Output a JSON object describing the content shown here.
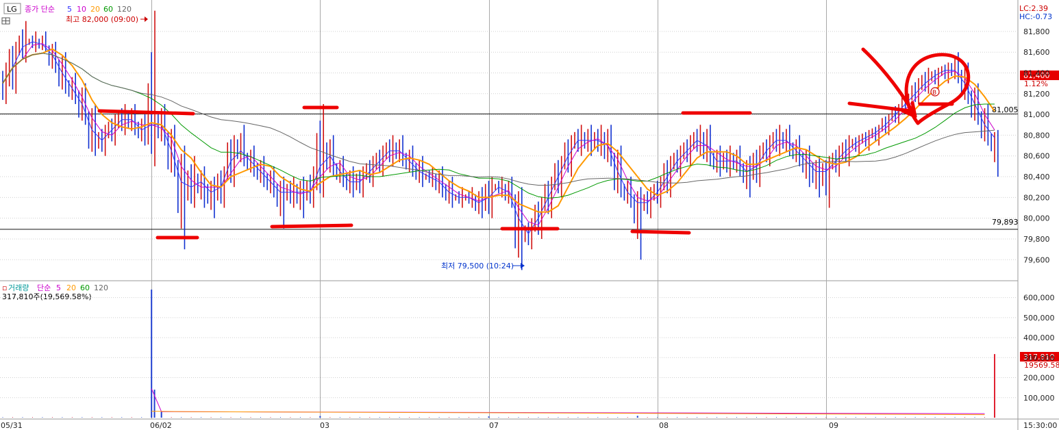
{
  "price_panel": {
    "ticker": "LG",
    "legend": {
      "title": "종가 단순",
      "periods": [
        "5",
        "10",
        "20",
        "60",
        "120"
      ],
      "colors": [
        "#3333ff",
        "#cc00cc",
        "#ff9900",
        "#009900",
        "#666666"
      ]
    },
    "high_marker": "최고 82,000 (09:00)",
    "low_marker": "최저 79,500 (10:24)",
    "top_right": {
      "lc": "LC:2.39",
      "hc": "HC:-0.73"
    },
    "current_price": "81,400",
    "current_change": "1.12%",
    "support_label": "79,893",
    "resistance_label": "81,005"
  },
  "volume_panel": {
    "title": "거래량",
    "legend": {
      "title": "단순",
      "periods": [
        "5",
        "20",
        "60",
        "120"
      ]
    },
    "current_line": "317,810주(19,569.58%)",
    "current_volume": "317,810",
    "current_pct": "19569.58%"
  },
  "x_axis": {
    "dates": [
      "05/31",
      "06/02",
      "03",
      "07",
      "08",
      "09"
    ],
    "time_label": "15:30:00"
  },
  "chart_data": [
    {
      "type": "bar",
      "title": "LG",
      "y_ticks": [
        "81,800",
        "81,600",
        "81,400",
        "81,200",
        "81,000",
        "80,800",
        "80,600",
        "80,400",
        "80,200",
        "80,000",
        "79,800",
        "79,600"
      ],
      "ylim": [
        79450,
        82050
      ],
      "high": 82000,
      "low": 79500,
      "horizontal_lines": [
        81005,
        79893
      ],
      "bars": [
        {
          "x": 0,
          "o": 81200,
          "h": 81500,
          "l": 81100,
          "c": 81300
        },
        {
          "x": 1,
          "o": 81300,
          "h": 81700,
          "l": 81200,
          "c": 81600
        },
        {
          "x": 2,
          "o": 81600,
          "h": 81900,
          "l": 81500,
          "c": 81700
        },
        {
          "x": 3,
          "o": 81700,
          "h": 81800,
          "l": 81600,
          "c": 81700
        },
        {
          "x": 4,
          "o": 81700,
          "h": 81800,
          "l": 81600,
          "c": 81650
        },
        {
          "x": 5,
          "o": 81650,
          "h": 81700,
          "l": 81400,
          "c": 81500
        },
        {
          "x": 6,
          "o": 81500,
          "h": 81600,
          "l": 81200,
          "c": 81300
        },
        {
          "x": 7,
          "o": 81300,
          "h": 81400,
          "l": 81100,
          "c": 81200
        },
        {
          "x": 8,
          "o": 81200,
          "h": 81300,
          "l": 80900,
          "c": 81000
        },
        {
          "x": 9,
          "o": 81000,
          "h": 81100,
          "l": 80600,
          "c": 80700
        },
        {
          "x": 10,
          "o": 80700,
          "h": 80900,
          "l": 80600,
          "c": 80800
        },
        {
          "x": 11,
          "o": 80800,
          "h": 81000,
          "l": 80700,
          "c": 80900
        },
        {
          "x": 12,
          "o": 80900,
          "h": 81100,
          "l": 80800,
          "c": 81000
        },
        {
          "x": 13,
          "o": 81000,
          "h": 81100,
          "l": 80800,
          "c": 80900
        },
        {
          "x": 14,
          "o": 80900,
          "h": 81000,
          "l": 80700,
          "c": 80800
        },
        {
          "x": 15,
          "o": 80800,
          "h": 82000,
          "l": 80500,
          "c": 81000
        },
        {
          "x": 16,
          "o": 81000,
          "h": 81100,
          "l": 80700,
          "c": 80800
        },
        {
          "x": 17,
          "o": 80800,
          "h": 80900,
          "l": 80400,
          "c": 80500
        },
        {
          "x": 18,
          "o": 80500,
          "h": 80700,
          "l": 79700,
          "c": 80200
        },
        {
          "x": 19,
          "o": 80200,
          "h": 80600,
          "l": 80100,
          "c": 80400
        },
        {
          "x": 20,
          "o": 80400,
          "h": 80500,
          "l": 80100,
          "c": 80300
        },
        {
          "x": 21,
          "o": 80300,
          "h": 80400,
          "l": 80000,
          "c": 80200
        },
        {
          "x": 22,
          "o": 80200,
          "h": 80500,
          "l": 80100,
          "c": 80400
        },
        {
          "x": 23,
          "o": 80400,
          "h": 80800,
          "l": 80300,
          "c": 80700
        },
        {
          "x": 24,
          "o": 80700,
          "h": 80900,
          "l": 80500,
          "c": 80600
        },
        {
          "x": 25,
          "o": 80600,
          "h": 80700,
          "l": 80400,
          "c": 80500
        },
        {
          "x": 26,
          "o": 80500,
          "h": 80600,
          "l": 80300,
          "c": 80400
        },
        {
          "x": 27,
          "o": 80400,
          "h": 80500,
          "l": 80200,
          "c": 80300
        },
        {
          "x": 28,
          "o": 80300,
          "h": 80400,
          "l": 79900,
          "c": 80200
        },
        {
          "x": 29,
          "o": 80200,
          "h": 80400,
          "l": 80100,
          "c": 80300
        },
        {
          "x": 30,
          "o": 80300,
          "h": 80400,
          "l": 80000,
          "c": 80200
        },
        {
          "x": 31,
          "o": 80200,
          "h": 80500,
          "l": 80100,
          "c": 80300
        },
        {
          "x": 32,
          "o": 80300,
          "h": 81100,
          "l": 80200,
          "c": 80700
        },
        {
          "x": 33,
          "o": 80700,
          "h": 80800,
          "l": 80400,
          "c": 80500
        },
        {
          "x": 34,
          "o": 80500,
          "h": 80600,
          "l": 80300,
          "c": 80400
        },
        {
          "x": 35,
          "o": 80400,
          "h": 80500,
          "l": 80200,
          "c": 80300
        },
        {
          "x": 36,
          "o": 80300,
          "h": 80500,
          "l": 80200,
          "c": 80400
        },
        {
          "x": 37,
          "o": 80400,
          "h": 80600,
          "l": 80300,
          "c": 80500
        },
        {
          "x": 38,
          "o": 80500,
          "h": 80700,
          "l": 80400,
          "c": 80600
        },
        {
          "x": 39,
          "o": 80600,
          "h": 80800,
          "l": 80500,
          "c": 80700
        },
        {
          "x": 40,
          "o": 80700,
          "h": 80800,
          "l": 80500,
          "c": 80600
        },
        {
          "x": 41,
          "o": 80600,
          "h": 80700,
          "l": 80400,
          "c": 80500
        },
        {
          "x": 42,
          "o": 80500,
          "h": 80600,
          "l": 80300,
          "c": 80400
        },
        {
          "x": 43,
          "o": 80400,
          "h": 80500,
          "l": 80300,
          "c": 80400
        },
        {
          "x": 44,
          "o": 80400,
          "h": 80500,
          "l": 80200,
          "c": 80300
        },
        {
          "x": 45,
          "o": 80300,
          "h": 80400,
          "l": 80100,
          "c": 80200
        },
        {
          "x": 46,
          "o": 80200,
          "h": 80300,
          "l": 80100,
          "c": 80200
        },
        {
          "x": 47,
          "o": 80200,
          "h": 80300,
          "l": 80100,
          "c": 80200
        },
        {
          "x": 48,
          "o": 80200,
          "h": 80300,
          "l": 80000,
          "c": 80100
        },
        {
          "x": 49,
          "o": 80100,
          "h": 80400,
          "l": 80000,
          "c": 80300
        },
        {
          "x": 50,
          "o": 80300,
          "h": 80400,
          "l": 80200,
          "c": 80300
        },
        {
          "x": 51,
          "o": 80300,
          "h": 80400,
          "l": 80100,
          "c": 80200
        },
        {
          "x": 52,
          "o": 80200,
          "h": 80300,
          "l": 79500,
          "c": 79800
        },
        {
          "x": 53,
          "o": 79800,
          "h": 80000,
          "l": 79700,
          "c": 79900
        },
        {
          "x": 54,
          "o": 79900,
          "h": 80200,
          "l": 79800,
          "c": 80100
        },
        {
          "x": 55,
          "o": 80100,
          "h": 80400,
          "l": 80000,
          "c": 80300
        },
        {
          "x": 56,
          "o": 80300,
          "h": 80600,
          "l": 80200,
          "c": 80500
        },
        {
          "x": 57,
          "o": 80500,
          "h": 80800,
          "l": 80400,
          "c": 80700
        },
        {
          "x": 58,
          "o": 80700,
          "h": 80900,
          "l": 80600,
          "c": 80800
        },
        {
          "x": 59,
          "o": 80800,
          "h": 80900,
          "l": 80600,
          "c": 80700
        },
        {
          "x": 60,
          "o": 80700,
          "h": 80900,
          "l": 80600,
          "c": 80800
        },
        {
          "x": 61,
          "o": 80800,
          "h": 80900,
          "l": 80500,
          "c": 80600
        },
        {
          "x": 62,
          "o": 80600,
          "h": 80700,
          "l": 80200,
          "c": 80300
        },
        {
          "x": 63,
          "o": 80300,
          "h": 80400,
          "l": 80100,
          "c": 80200
        },
        {
          "x": 64,
          "o": 80200,
          "h": 80300,
          "l": 79600,
          "c": 80100
        },
        {
          "x": 65,
          "o": 80100,
          "h": 80300,
          "l": 80000,
          "c": 80200
        },
        {
          "x": 66,
          "o": 80200,
          "h": 80400,
          "l": 80100,
          "c": 80300
        },
        {
          "x": 67,
          "o": 80300,
          "h": 80600,
          "l": 80200,
          "c": 80500
        },
        {
          "x": 68,
          "o": 80500,
          "h": 80700,
          "l": 80400,
          "c": 80600
        },
        {
          "x": 69,
          "o": 80600,
          "h": 80800,
          "l": 80500,
          "c": 80700
        },
        {
          "x": 70,
          "o": 80700,
          "h": 80900,
          "l": 80600,
          "c": 80800
        },
        {
          "x": 71,
          "o": 80800,
          "h": 80900,
          "l": 80500,
          "c": 80600
        },
        {
          "x": 72,
          "o": 80600,
          "h": 80700,
          "l": 80400,
          "c": 80500
        },
        {
          "x": 73,
          "o": 80500,
          "h": 80700,
          "l": 80400,
          "c": 80600
        },
        {
          "x": 74,
          "o": 80600,
          "h": 80700,
          "l": 80400,
          "c": 80500
        },
        {
          "x": 75,
          "o": 80500,
          "h": 80600,
          "l": 80200,
          "c": 80400
        },
        {
          "x": 76,
          "o": 80400,
          "h": 80700,
          "l": 80300,
          "c": 80600
        },
        {
          "x": 77,
          "o": 80600,
          "h": 80800,
          "l": 80500,
          "c": 80700
        },
        {
          "x": 78,
          "o": 80700,
          "h": 80900,
          "l": 80600,
          "c": 80800
        },
        {
          "x": 79,
          "o": 80800,
          "h": 80900,
          "l": 80600,
          "c": 80700
        },
        {
          "x": 80,
          "o": 80700,
          "h": 80800,
          "l": 80500,
          "c": 80600
        },
        {
          "x": 81,
          "o": 80600,
          "h": 80700,
          "l": 80300,
          "c": 80500
        },
        {
          "x": 82,
          "o": 80500,
          "h": 80600,
          "l": 80200,
          "c": 80400
        },
        {
          "x": 83,
          "o": 80400,
          "h": 80600,
          "l": 80100,
          "c": 80500
        },
        {
          "x": 84,
          "o": 80500,
          "h": 80700,
          "l": 80400,
          "c": 80600
        },
        {
          "x": 85,
          "o": 80600,
          "h": 80800,
          "l": 80500,
          "c": 80700
        },
        {
          "x": 86,
          "o": 80700,
          "h": 80800,
          "l": 80600,
          "c": 80750
        },
        {
          "x": 87,
          "o": 80750,
          "h": 80850,
          "l": 80650,
          "c": 80800
        },
        {
          "x": 88,
          "o": 80800,
          "h": 80900,
          "l": 80700,
          "c": 80850
        },
        {
          "x": 89,
          "o": 80850,
          "h": 81000,
          "l": 80800,
          "c": 80950
        },
        {
          "x": 90,
          "o": 80950,
          "h": 81100,
          "l": 80900,
          "c": 81050
        },
        {
          "x": 91,
          "o": 81050,
          "h": 81200,
          "l": 81000,
          "c": 81150
        },
        {
          "x": 92,
          "o": 81150,
          "h": 81350,
          "l": 81100,
          "c": 81250
        },
        {
          "x": 93,
          "o": 81250,
          "h": 81450,
          "l": 81200,
          "c": 81350
        },
        {
          "x": 94,
          "o": 81350,
          "h": 81450,
          "l": 81250,
          "c": 81400
        },
        {
          "x": 95,
          "o": 81400,
          "h": 81500,
          "l": 81300,
          "c": 81450
        },
        {
          "x": 96,
          "o": 81450,
          "h": 81600,
          "l": 81300,
          "c": 81400
        },
        {
          "x": 97,
          "o": 81400,
          "h": 81500,
          "l": 81100,
          "c": 81200
        },
        {
          "x": 98,
          "o": 81200,
          "h": 81300,
          "l": 80900,
          "c": 81000
        },
        {
          "x": 99,
          "o": 81000,
          "h": 81100,
          "l": 80700,
          "c": 80800
        },
        {
          "x": 100,
          "o": 80800,
          "h": 80850,
          "l": 80400,
          "c": 80750
        }
      ],
      "series": [
        {
          "name": "5",
          "color": "#3333ff"
        },
        {
          "name": "10",
          "color": "#cc00cc"
        },
        {
          "name": "20",
          "color": "#ff9900"
        },
        {
          "name": "60",
          "color": "#009900"
        },
        {
          "name": "120",
          "color": "#666666"
        }
      ]
    },
    {
      "type": "bar",
      "title": "거래량",
      "y_ticks": [
        "600,000",
        "500,000",
        "400,000",
        "300,000",
        "200,000",
        "100,000"
      ],
      "ylim": [
        0,
        650000
      ],
      "values": [
        {
          "x": 15,
          "v": 640000
        },
        {
          "x": 15.3,
          "v": 140000
        },
        {
          "x": 16,
          "v": 30000
        },
        {
          "x": 32,
          "v": 8000
        },
        {
          "x": 49,
          "v": 6000
        },
        {
          "x": 64,
          "v": 9000
        },
        {
          "x": 100,
          "v": 317810
        }
      ]
    }
  ]
}
